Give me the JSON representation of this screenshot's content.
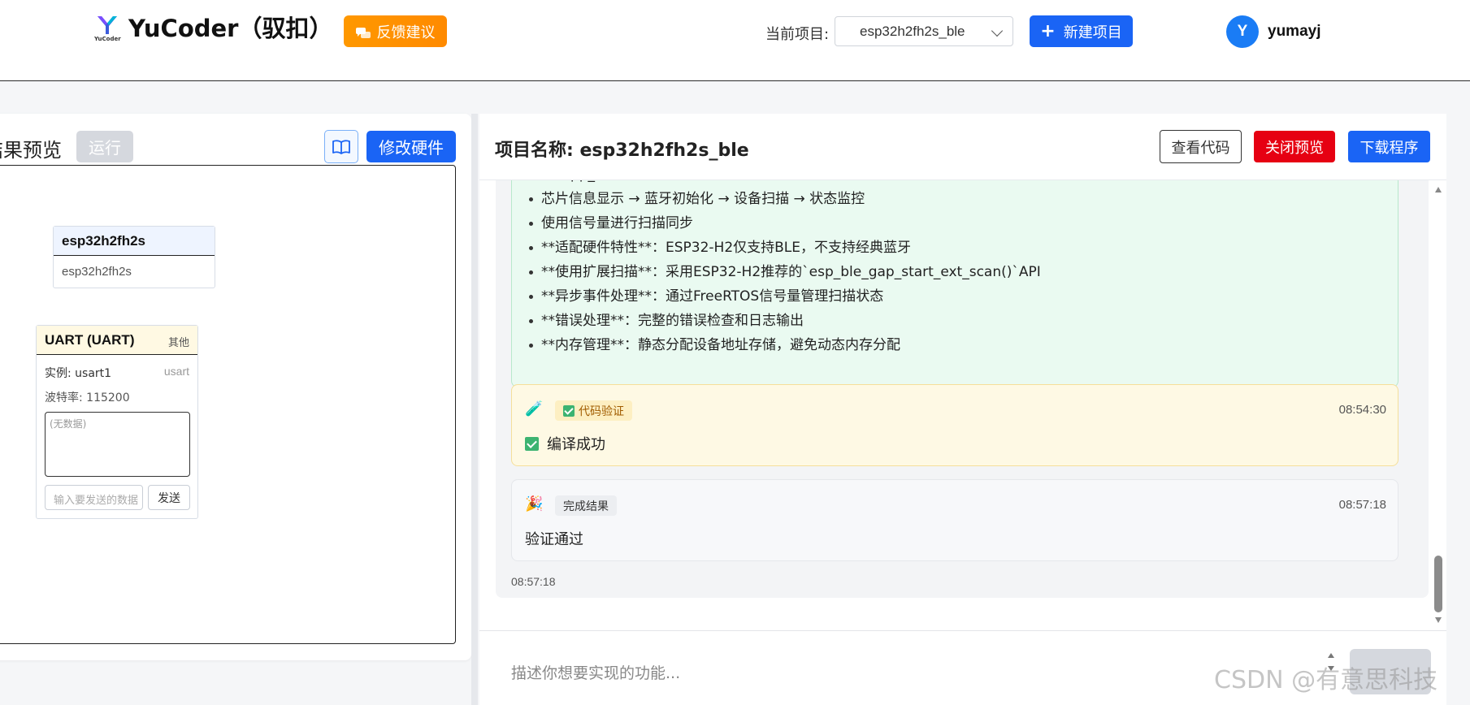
{
  "header": {
    "brand": "YuCoder（驭扣）",
    "logo_sub": "YuCoder",
    "feedback_label": "反馈建议",
    "project_label": "当前项目:",
    "project_value": "esp32h2fh2s_ble",
    "new_project_label": "新建项目",
    "avatar_letter": "Y",
    "username": "yumayj"
  },
  "left": {
    "title": "结果预览",
    "run_label": "运行",
    "modify_label": "修改硬件",
    "chip_card": {
      "title": "esp32h2fh2s",
      "subtitle": "esp32h2fh2s"
    },
    "uart_card": {
      "title": "UART (UART)",
      "tag": "其他",
      "instance": "实例: usart1",
      "instance_type": "usart",
      "baud": "波特率: 115200",
      "log_placeholder": "(无数据)",
      "input_placeholder": "输入要发送的数据",
      "send_label": "发送"
    }
  },
  "right": {
    "project_title": "项目名称: esp32h2fh2s_ble",
    "view_code_label": "查看代码",
    "close_preview_label": "关闭预览",
    "download_label": "下载程序",
    "summary_items": [
      "在`app_main()`中实现完整的BLE流程",
      "芯片信息显示 → 蓝牙初始化 → 设备扫描 → 状态监控",
      "使用信号量进行扫描同步",
      "**适配硬件特性**：ESP32-H2仅支持BLE，不支持经典蓝牙",
      "**使用扩展扫描**：采用ESP32-H2推荐的`esp_ble_gap_start_ext_scan()`API",
      "**异步事件处理**：通过FreeRTOS信号量管理扫描状态",
      "**错误处理**：完整的错误检查和日志输出",
      "**内存管理**：静态分配设备地址存储，避免动态内存分配"
    ],
    "verify": {
      "icon": "🧪",
      "badge": "代码验证",
      "time": "08:54:30",
      "body": "编译成功"
    },
    "done": {
      "icon": "🎉",
      "badge": "完成结果",
      "time": "08:57:18",
      "body": "验证通过"
    },
    "footer_time": "08:57:18",
    "prompt_placeholder": "描述你想要实现的功能..."
  },
  "watermark": "CSDN @有意思科技",
  "colors": {
    "primary": "#1a64f5",
    "danger": "#e60012",
    "feedback": "#ff8a00",
    "success_bg": "#eafaf1",
    "warn_bg": "#fef9e4"
  }
}
